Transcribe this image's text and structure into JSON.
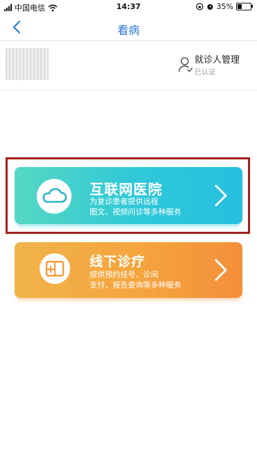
{
  "status_bar": {
    "carrier": "中国电信",
    "time": "14:37",
    "battery": "35%",
    "battery_level": 0.35
  },
  "nav": {
    "title": "看病"
  },
  "user": {
    "manage_label": "就诊人管理",
    "verified_label": "已认证"
  },
  "services": [
    {
      "title": "互联网医院",
      "desc_line1": "为复诊患者提供远程",
      "desc_line2": "图文、视频问诊等多种服务",
      "icon": "cloud-icon"
    },
    {
      "title": "线下诊疗",
      "desc_line1": "提供预约挂号、诊间",
      "desc_line2": "支付、报告查询等多种服务",
      "icon": "clinic-icon"
    }
  ],
  "colors": {
    "accent": "#2b7ad6",
    "highlight": "#a3201c",
    "online_card": "#2ec8d8",
    "offline_card": "#f5a43e"
  }
}
